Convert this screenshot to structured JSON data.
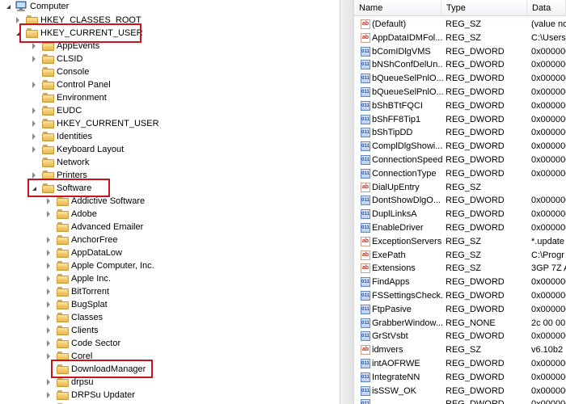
{
  "tree": {
    "root_label": "Computer",
    "items": [
      {
        "label": "HKEY_CLASSES_ROOT",
        "expander": "closed",
        "level": 1
      },
      {
        "label": "HKEY_CURRENT_USER",
        "expander": "open",
        "level": 1
      },
      {
        "label": "AppEvents",
        "expander": "closed",
        "level": 2
      },
      {
        "label": "CLSID",
        "expander": "closed",
        "level": 2
      },
      {
        "label": "Console",
        "expander": "none",
        "level": 2
      },
      {
        "label": "Control Panel",
        "expander": "closed",
        "level": 2
      },
      {
        "label": "Environment",
        "expander": "none",
        "level": 2
      },
      {
        "label": "EUDC",
        "expander": "closed",
        "level": 2
      },
      {
        "label": "HKEY_CURRENT_USER",
        "expander": "closed",
        "level": 2
      },
      {
        "label": "Identities",
        "expander": "closed",
        "level": 2
      },
      {
        "label": "Keyboard Layout",
        "expander": "closed",
        "level": 2
      },
      {
        "label": "Network",
        "expander": "none",
        "level": 2
      },
      {
        "label": "Printers",
        "expander": "closed",
        "level": 2
      },
      {
        "label": "Software",
        "expander": "open",
        "level": 2
      },
      {
        "label": "Addictive Software",
        "expander": "closed",
        "level": 3
      },
      {
        "label": "Adobe",
        "expander": "closed",
        "level": 3
      },
      {
        "label": "Advanced Emailer",
        "expander": "none",
        "level": 3
      },
      {
        "label": "AnchorFree",
        "expander": "closed",
        "level": 3
      },
      {
        "label": "AppDataLow",
        "expander": "closed",
        "level": 3
      },
      {
        "label": "Apple Computer, Inc.",
        "expander": "closed",
        "level": 3
      },
      {
        "label": "Apple Inc.",
        "expander": "closed",
        "level": 3
      },
      {
        "label": "BitTorrent",
        "expander": "closed",
        "level": 3
      },
      {
        "label": "BugSplat",
        "expander": "closed",
        "level": 3
      },
      {
        "label": "Classes",
        "expander": "closed",
        "level": 3
      },
      {
        "label": "Clients",
        "expander": "closed",
        "level": 3
      },
      {
        "label": "Code Sector",
        "expander": "closed",
        "level": 3
      },
      {
        "label": "Corel",
        "expander": "closed",
        "level": 3
      },
      {
        "label": "DownloadManager",
        "expander": "none",
        "level": 3
      },
      {
        "label": "drpsu",
        "expander": "closed",
        "level": 3
      },
      {
        "label": "DRPSu Updater",
        "expander": "closed",
        "level": 3
      },
      {
        "label": "",
        "expander": "closed",
        "level": 3
      }
    ]
  },
  "list": {
    "columns": {
      "name": "Name",
      "type": "Type",
      "data": "Data"
    },
    "rows": [
      {
        "icon": "string",
        "name": "(Default)",
        "type": "REG_SZ",
        "data": "(value no"
      },
      {
        "icon": "string",
        "name": "AppDataIDMFol...",
        "type": "REG_SZ",
        "data": "C:\\Users\\"
      },
      {
        "icon": "binary",
        "name": "bComIDlgVMS",
        "type": "REG_DWORD",
        "data": "0x000000"
      },
      {
        "icon": "binary",
        "name": "bNShConfDelUn...",
        "type": "REG_DWORD",
        "data": "0x000000"
      },
      {
        "icon": "binary",
        "name": "bQueueSelPnlO...",
        "type": "REG_DWORD",
        "data": "0x000000"
      },
      {
        "icon": "binary",
        "name": "bQueueSelPnlO...",
        "type": "REG_DWORD",
        "data": "0x000000"
      },
      {
        "icon": "binary",
        "name": "bShBTtFQCI",
        "type": "REG_DWORD",
        "data": "0x000000"
      },
      {
        "icon": "binary",
        "name": "bShFF8Tip1",
        "type": "REG_DWORD",
        "data": "0x000000"
      },
      {
        "icon": "binary",
        "name": "bShTipDD",
        "type": "REG_DWORD",
        "data": "0x000000"
      },
      {
        "icon": "binary",
        "name": "ComplDlgShowi...",
        "type": "REG_DWORD",
        "data": "0x000000"
      },
      {
        "icon": "binary",
        "name": "ConnectionSpeed",
        "type": "REG_DWORD",
        "data": "0x000000"
      },
      {
        "icon": "binary",
        "name": "ConnectionType",
        "type": "REG_DWORD",
        "data": "0x000000"
      },
      {
        "icon": "string",
        "name": "DialUpEntry",
        "type": "REG_SZ",
        "data": ""
      },
      {
        "icon": "binary",
        "name": "DontShowDlgO...",
        "type": "REG_DWORD",
        "data": "0x000000"
      },
      {
        "icon": "binary",
        "name": "DuplLinksA",
        "type": "REG_DWORD",
        "data": "0x000000"
      },
      {
        "icon": "binary",
        "name": "EnableDriver",
        "type": "REG_DWORD",
        "data": "0x000000"
      },
      {
        "icon": "string",
        "name": "ExceptionServers",
        "type": "REG_SZ",
        "data": "*.update"
      },
      {
        "icon": "string",
        "name": "ExePath",
        "type": "REG_SZ",
        "data": "C:\\Progr"
      },
      {
        "icon": "string",
        "name": "Extensions",
        "type": "REG_SZ",
        "data": "3GP 7Z A"
      },
      {
        "icon": "binary",
        "name": "FindApps",
        "type": "REG_DWORD",
        "data": "0x000000"
      },
      {
        "icon": "binary",
        "name": "FSSettingsCheck...",
        "type": "REG_DWORD",
        "data": "0x000000"
      },
      {
        "icon": "binary",
        "name": "FtpPasive",
        "type": "REG_DWORD",
        "data": "0x000000"
      },
      {
        "icon": "binary",
        "name": "GrabberWindow...",
        "type": "REG_NONE",
        "data": "2c 00 00 0"
      },
      {
        "icon": "binary",
        "name": "GrStVsbt",
        "type": "REG_DWORD",
        "data": "0x000000"
      },
      {
        "icon": "string",
        "name": "idmvers",
        "type": "REG_SZ",
        "data": "v6.10b2 I"
      },
      {
        "icon": "binary",
        "name": "intAOFRWE",
        "type": "REG_DWORD",
        "data": "0x000000"
      },
      {
        "icon": "binary",
        "name": "IntegrateNN",
        "type": "REG_DWORD",
        "data": "0x000000"
      },
      {
        "icon": "binary",
        "name": "isSSW_OK",
        "type": "REG_DWORD",
        "data": "0x000000"
      },
      {
        "icon": "binary",
        "name": "",
        "type": "REG_DWORD",
        "data": "0x000000"
      }
    ]
  },
  "colors": {
    "highlight": "#c8141e",
    "folder": "#e7b54d"
  }
}
